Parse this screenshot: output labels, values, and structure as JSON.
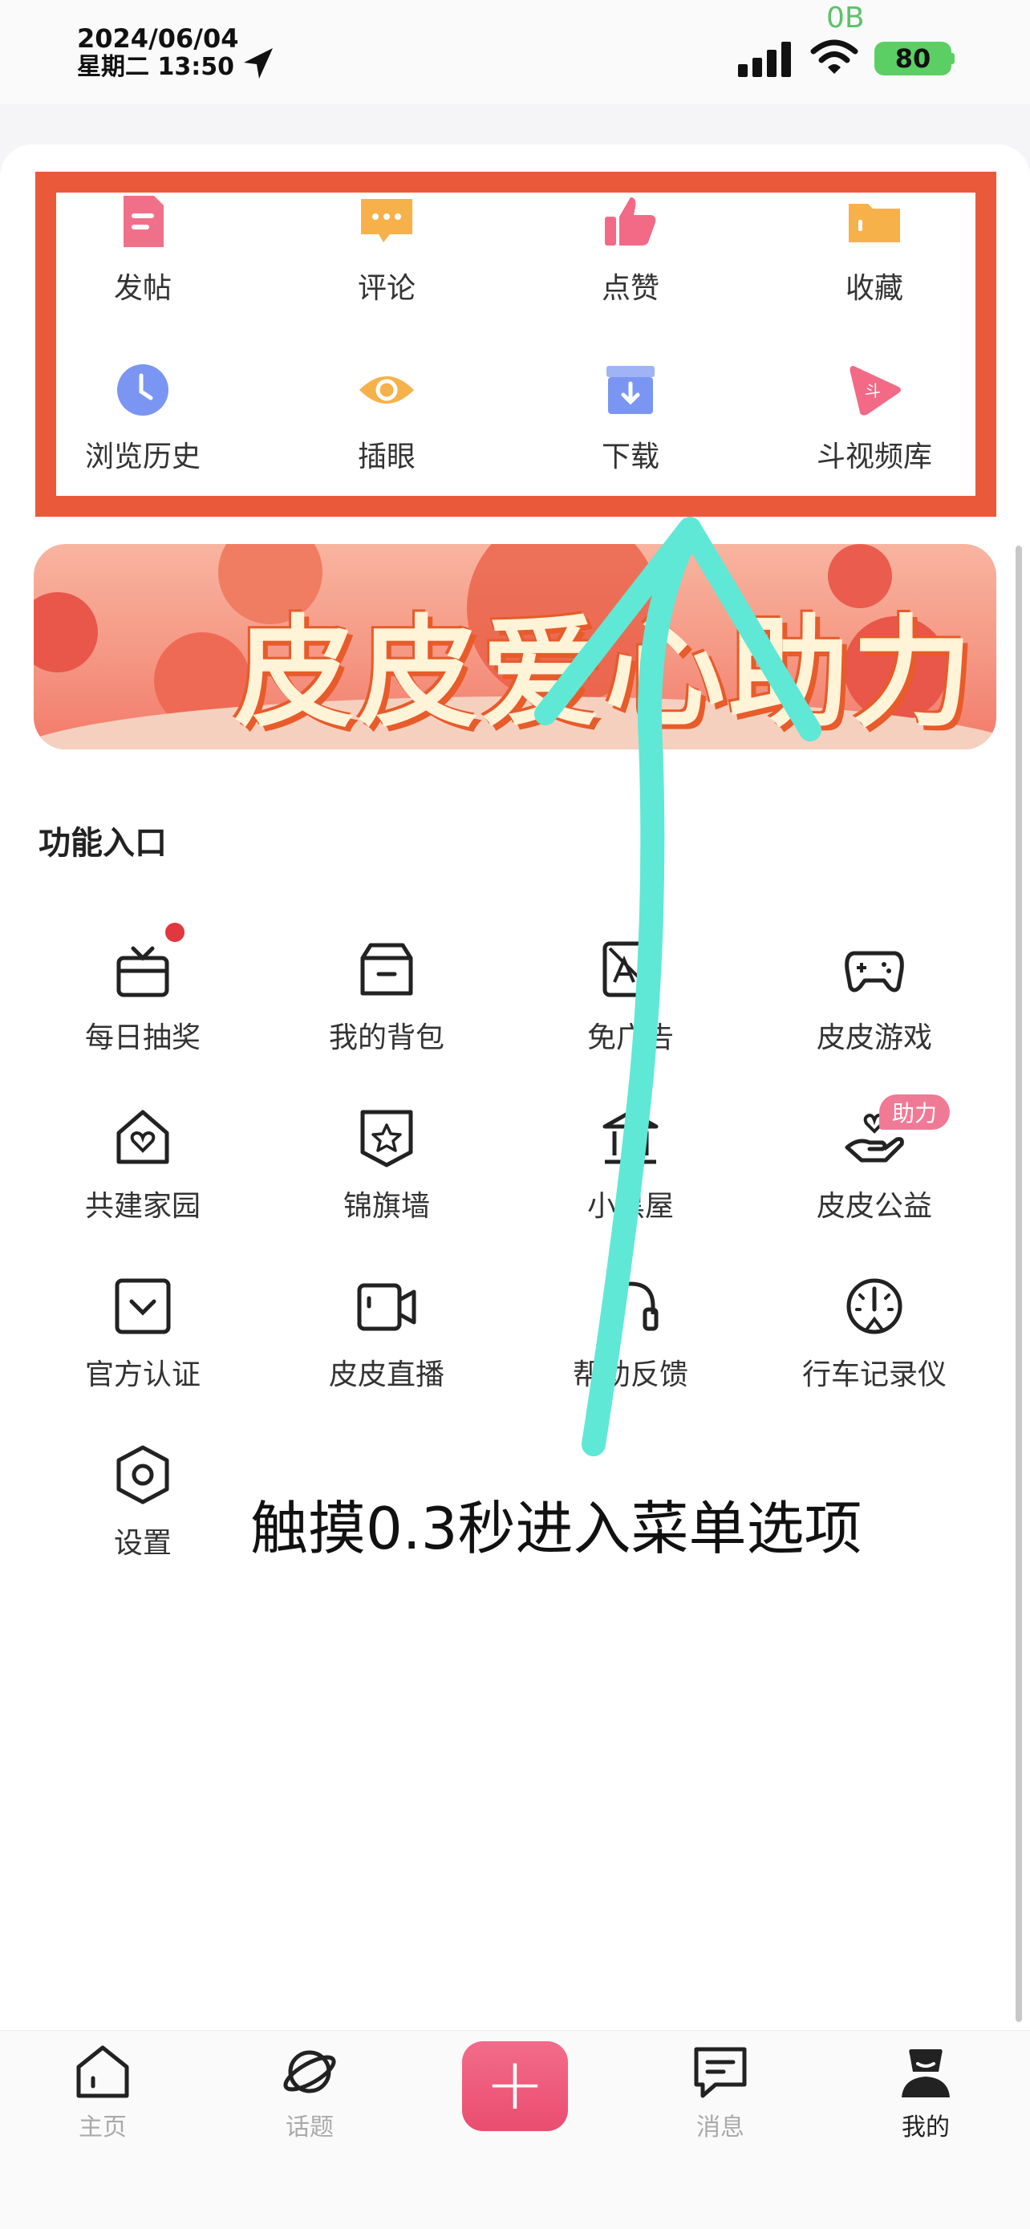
{
  "status_bar": {
    "date": "2024/06/04",
    "weekday_time": "星期二 13:50",
    "net_speed": "0B",
    "battery": "80"
  },
  "quick_actions": [
    {
      "label": "发帖",
      "icon": "post-icon",
      "color": "#f0708a"
    },
    {
      "label": "评论",
      "icon": "comment-icon",
      "color": "#f7b14a"
    },
    {
      "label": "点赞",
      "icon": "thumbs-up-icon",
      "color": "#f26a86"
    },
    {
      "label": "收藏",
      "icon": "folder-icon",
      "color": "#f7b14a"
    },
    {
      "label": "浏览历史",
      "icon": "clock-icon",
      "color": "#7a96f2"
    },
    {
      "label": "插眼",
      "icon": "eye-icon",
      "color": "#f7b14a"
    },
    {
      "label": "下载",
      "icon": "download-box-icon",
      "color": "#7a96f2"
    },
    {
      "label": "斗视频库",
      "icon": "video-library-icon",
      "color": "#f26a86"
    }
  ],
  "banner": {
    "title": "皮皮爱心助力"
  },
  "section": {
    "title": "功能入口"
  },
  "functions": [
    {
      "label": "每日抽奖",
      "icon": "gift-icon"
    },
    {
      "label": "我的背包",
      "icon": "backpack-icon"
    },
    {
      "label": "免广告",
      "icon": "no-ads-icon"
    },
    {
      "label": "皮皮游戏",
      "icon": "gamepad-icon"
    },
    {
      "label": "共建家园",
      "icon": "home-heart-icon"
    },
    {
      "label": "锦旗墙",
      "icon": "badge-star-icon"
    },
    {
      "label": "小黑屋",
      "icon": "bank-building-icon"
    },
    {
      "label": "皮皮公益",
      "icon": "charity-hand-icon",
      "badge": "助力"
    },
    {
      "label": "官方认证",
      "icon": "certified-icon"
    },
    {
      "label": "皮皮直播",
      "icon": "live-camera-icon"
    },
    {
      "label": "帮助反馈",
      "icon": "headset-icon"
    },
    {
      "label": "行车记录仪",
      "icon": "dashcam-gauge-icon"
    },
    {
      "label": "设置",
      "icon": "settings-hex-icon"
    }
  ],
  "overlay_text": "触摸0.3秒进入菜单选项",
  "tab_bar": {
    "tabs": [
      {
        "label": "主页",
        "icon": "home-icon"
      },
      {
        "label": "话题",
        "icon": "planet-icon"
      },
      {
        "label": "消息",
        "icon": "message-icon"
      },
      {
        "label": "我的",
        "icon": "profile-icon"
      }
    ],
    "plus": "+"
  },
  "colors": {
    "highlight": "#ea5a3a",
    "accent": "#ea4d70",
    "arrow": "#5fe8d6"
  }
}
